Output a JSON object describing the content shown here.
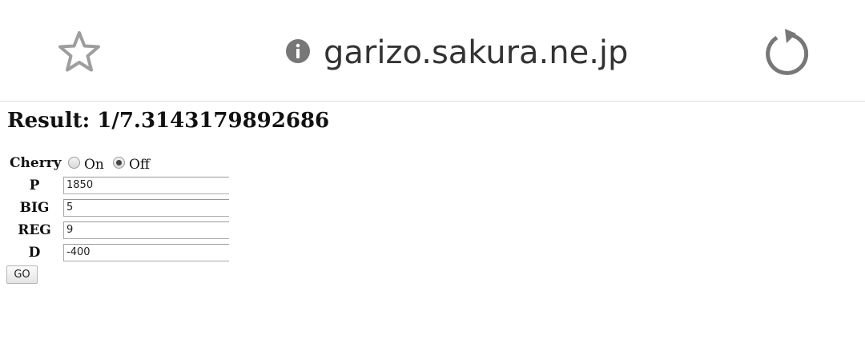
{
  "browser": {
    "url": "garizo.sakura.ne.jp",
    "icons": {
      "bookmark": "star-icon",
      "site_info": "info-icon",
      "reload": "reload-icon"
    }
  },
  "page": {
    "result": "Result: 1/7.3143179892686",
    "form": {
      "cherry": {
        "label": "Cherry",
        "options": [
          {
            "label": "On",
            "checked": false
          },
          {
            "label": "Off",
            "checked": true
          }
        ]
      },
      "fields": [
        {
          "label": "P",
          "value": "1850"
        },
        {
          "label": "BIG",
          "value": "5"
        },
        {
          "label": "REG",
          "value": "9"
        },
        {
          "label": "D",
          "value": "-400"
        }
      ],
      "submit_label": "GO"
    }
  }
}
